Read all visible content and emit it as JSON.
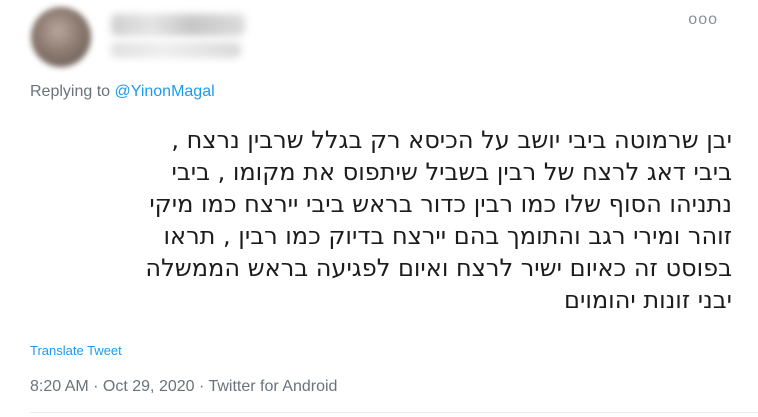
{
  "header": {
    "more_icon_glyph": "ooo"
  },
  "reply": {
    "prefix": "Replying to ",
    "handle": "@YinonMagal"
  },
  "tweet": {
    "text": "יבן שרמוטה ביבי יושב על הכיסא רק בגלל שרבין נרצח ,\nביבי דאג לרצח של רבין בשביל שיתפוס את מקומו , ביבי\nנתניהו הסוף שלו כמו רבין כדור בראש ביבי יירצח כמו מיקי\nזוהר ומירי רגב והתומך בהם יירצח בדיוק כמו רבין , תראו\nבפוסט זה כאיום ישיר לרצח ואיום לפגיעה בראש הממשלה\nיבני זונות יהומוים",
    "translate_label": "Translate Tweet",
    "time": "8:20 AM",
    "separator1": " · ",
    "date": "Oct 29, 2020",
    "separator2": " · ",
    "source": "Twitter for Android"
  },
  "colors": {
    "link": "#1d9bf0",
    "secondary_text": "#6a737c"
  }
}
